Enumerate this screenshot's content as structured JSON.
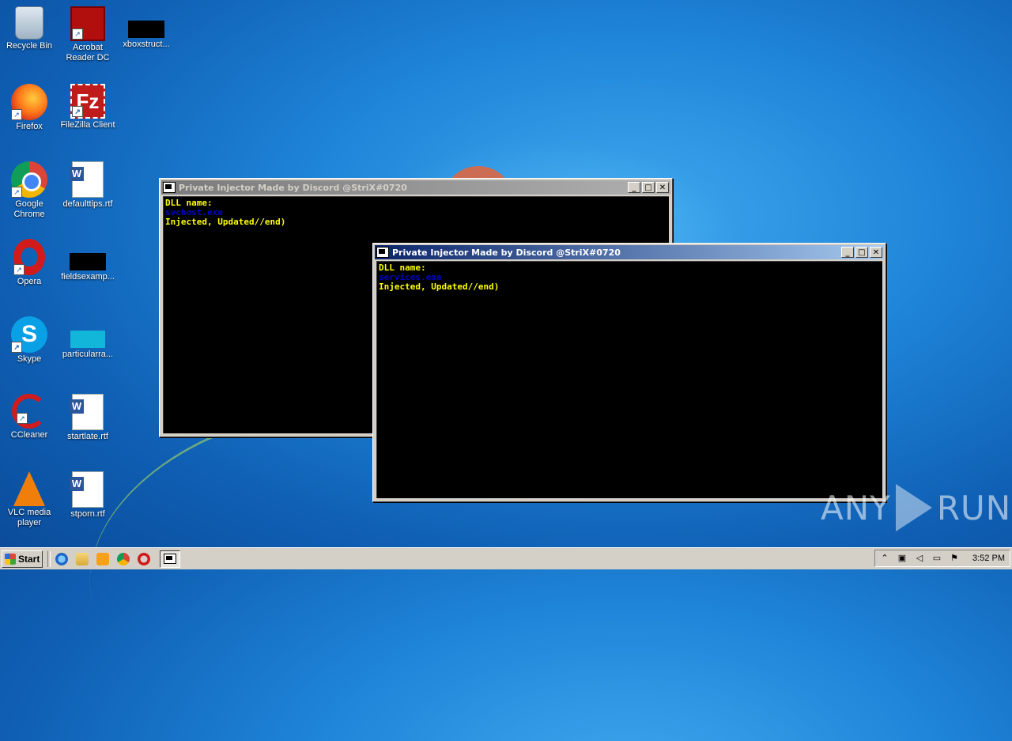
{
  "desktop": {
    "icons": [
      {
        "label": "Recycle Bin",
        "icon": "recycle-bin-icon"
      },
      {
        "label": "Acrobat Reader DC",
        "icon": "acrobat-icon"
      },
      {
        "label": "xboxstruct...",
        "icon": "file-icon"
      },
      {
        "label": "Firefox",
        "icon": "firefox-icon"
      },
      {
        "label": "FileZilla Client",
        "icon": "filezilla-icon"
      },
      {
        "label": "Google Chrome",
        "icon": "chrome-icon"
      },
      {
        "label": "defaulttips.rtf",
        "icon": "word-doc-icon"
      },
      {
        "label": "Opera",
        "icon": "opera-icon"
      },
      {
        "label": "fieldsexamp...",
        "icon": "file-icon"
      },
      {
        "label": "Skype",
        "icon": "skype-icon"
      },
      {
        "label": "particularra...",
        "icon": "file-icon"
      },
      {
        "label": "CCleaner",
        "icon": "ccleaner-icon"
      },
      {
        "label": "startlate.rtf",
        "icon": "word-doc-icon"
      },
      {
        "label": "VLC media player",
        "icon": "vlc-icon"
      },
      {
        "label": "stporn.rtf",
        "icon": "word-doc-icon"
      }
    ]
  },
  "windows": [
    {
      "title": "Private Injector Made by Discord @StriX#0720",
      "lines": [
        "DLL name:",
        "svchost.exe",
        "Injected, Updated//end)"
      ]
    },
    {
      "title": "Private Injector Made by Discord @StriX#0720",
      "lines": [
        "DLL name:",
        "services.exe",
        "Injected, Updated//end)"
      ]
    }
  ],
  "titlebar_buttons": {
    "minimize": "_",
    "maximize": "□",
    "close": "✕"
  },
  "taskbar": {
    "start_label": "Start",
    "clock": "3:52 PM",
    "tray_icons": [
      "chevron-up-icon",
      "network-icon",
      "volume-icon",
      "battery-icon",
      "flag-icon"
    ]
  },
  "watermark": {
    "text_left": "ANY",
    "text_right": "RUN"
  },
  "colors": {
    "console_text": "#ffff00",
    "console_process": "#0000c8",
    "active_title": "#0a246a"
  }
}
